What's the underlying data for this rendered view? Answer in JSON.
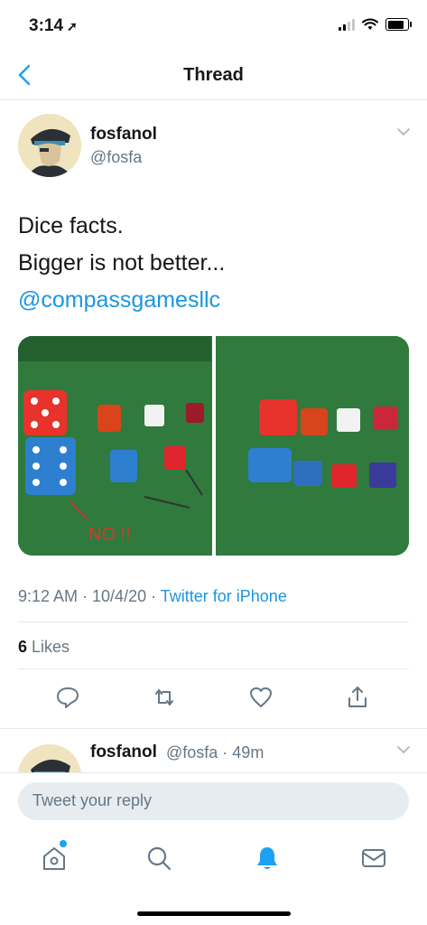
{
  "status_bar": {
    "time": "3:14",
    "location_glyph": "➚"
  },
  "navbar": {
    "title": "Thread",
    "back_icon": "chevron-left-icon"
  },
  "tweet": {
    "author_name": "fosfanol",
    "author_handle": "@fosfa",
    "text_line1": "Dice facts.",
    "text_line2": "Bigger is not better...",
    "mention": "@compassgamesllc",
    "timestamp": "9:12 AM · 10/4/20 · ",
    "source": "Twitter for iPhone",
    "likes_count": "6",
    "likes_label": "Likes",
    "image_annotation": "NO !!"
  },
  "reply": {
    "author_name": "fosfanol",
    "meta": "@fosfa · 49m"
  },
  "composer": {
    "placeholder": "Tweet your reply"
  },
  "colors": {
    "accent": "#1b95e0",
    "muted": "#657786",
    "felt": "#2f7a3c"
  }
}
